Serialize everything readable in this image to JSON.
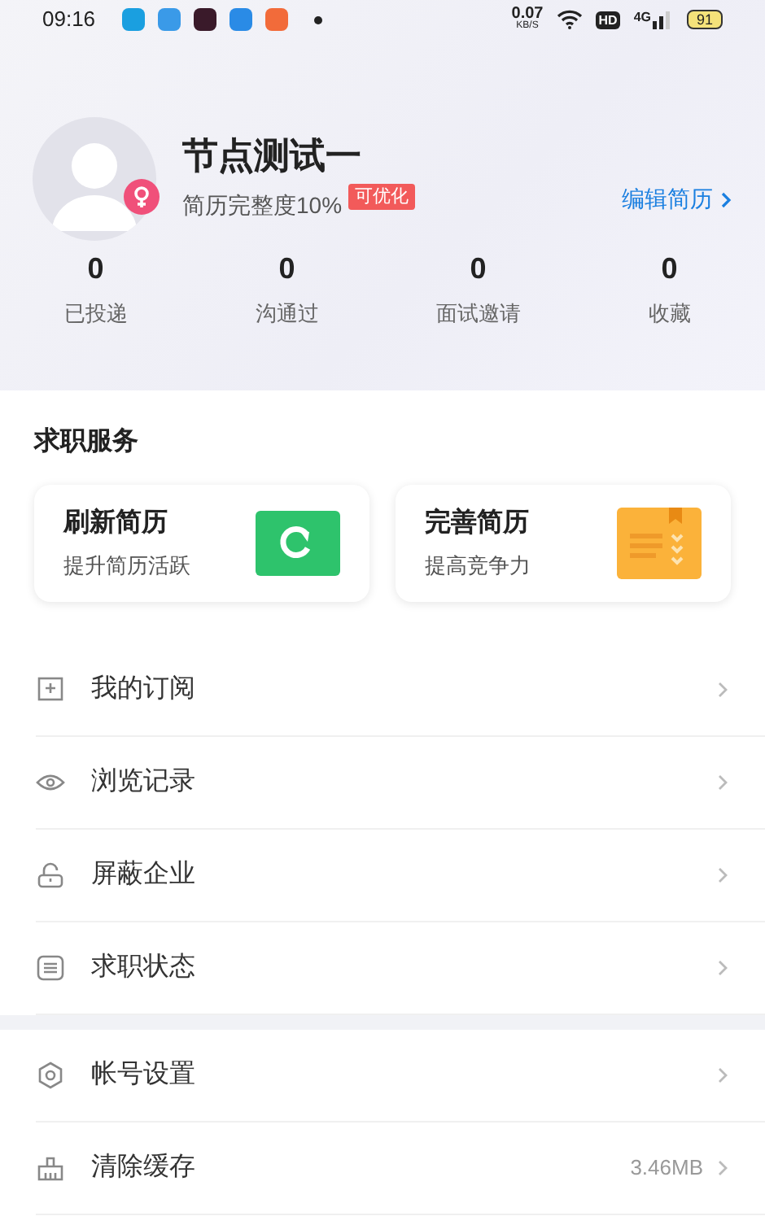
{
  "status_bar": {
    "time": "09:16",
    "speed": "0.07",
    "speed_unit": "KB/S",
    "hd": "HD",
    "network": "4G",
    "battery": "91"
  },
  "profile": {
    "name": "节点测试一",
    "completeness": "简历完整度10%",
    "tag": "可优化",
    "edit_link": "编辑简历"
  },
  "stats": [
    {
      "value": "0",
      "label": "已投递"
    },
    {
      "value": "0",
      "label": "沟通过"
    },
    {
      "value": "0",
      "label": "面试邀请"
    },
    {
      "value": "0",
      "label": "收藏"
    }
  ],
  "services": {
    "title": "求职服务",
    "cards": [
      {
        "title": "刷新简历",
        "subtitle": "提升简历活跃"
      },
      {
        "title": "完善简历",
        "subtitle": "提高竞争力"
      }
    ]
  },
  "menu_groups": [
    [
      {
        "label": "我的订阅"
      },
      {
        "label": "浏览记录"
      },
      {
        "label": "屏蔽企业"
      },
      {
        "label": "求职状态"
      }
    ],
    [
      {
        "label": "帐号设置"
      },
      {
        "label": "清除缓存",
        "value": "3.46MB"
      }
    ]
  ]
}
